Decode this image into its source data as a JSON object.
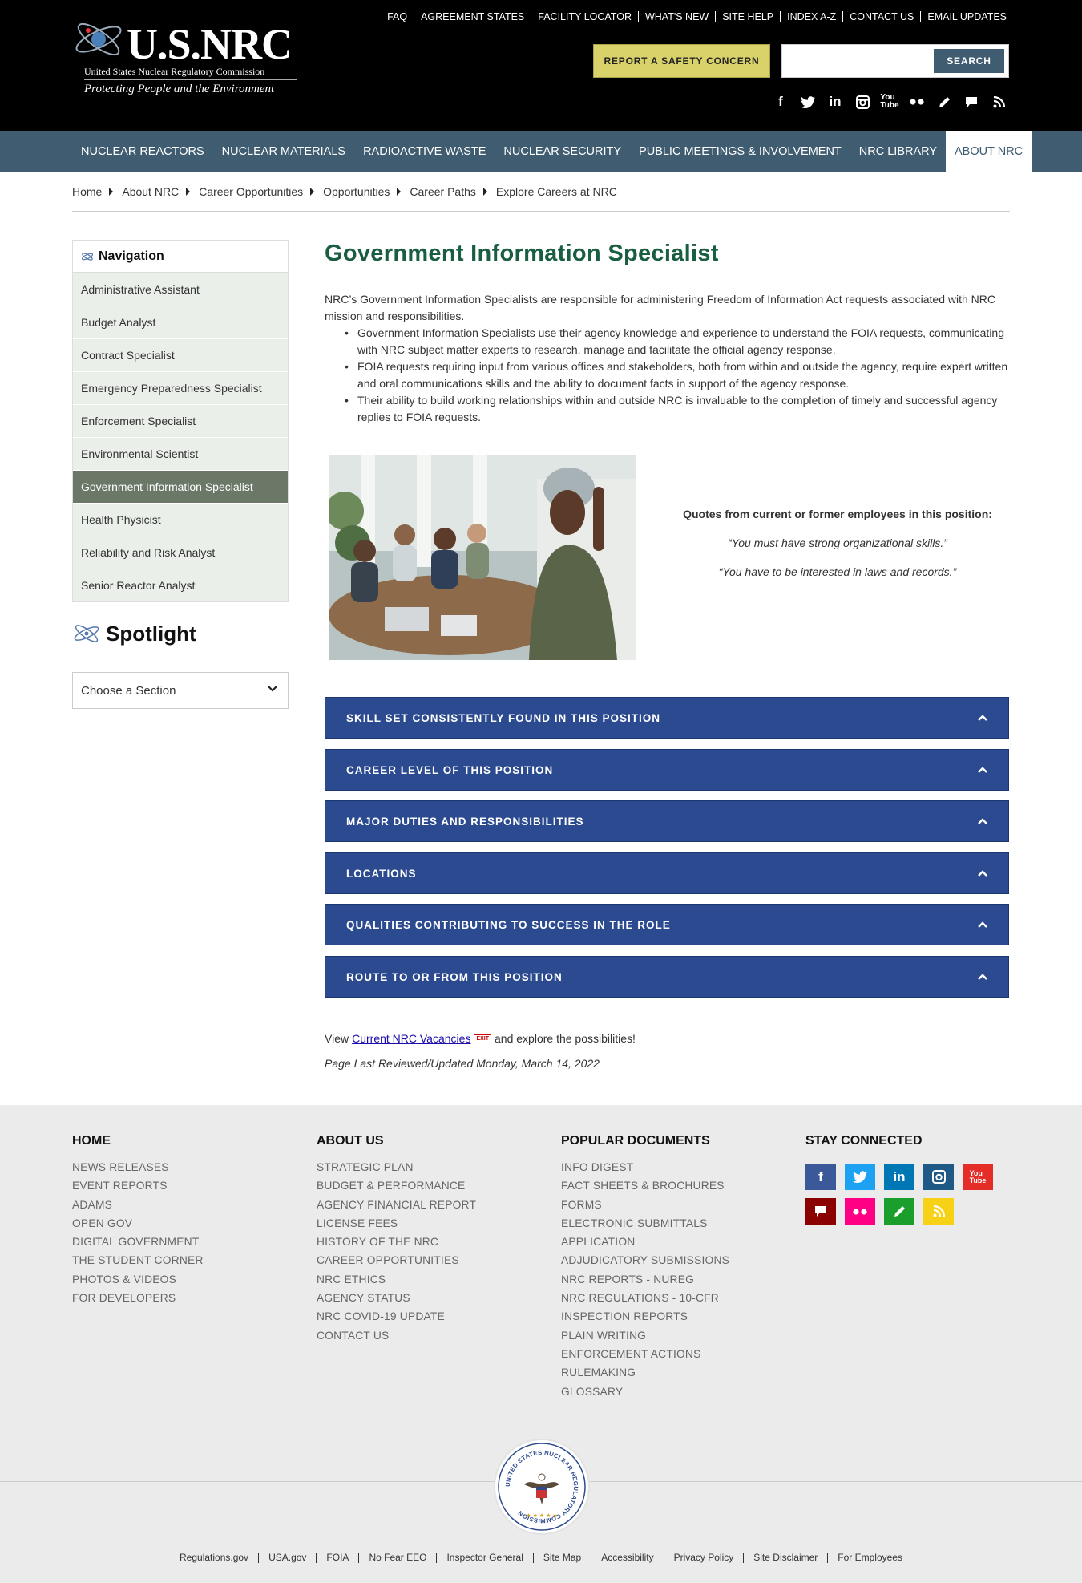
{
  "header": {
    "logo_text": "U.S.NRC",
    "logo_subtitle": "United States Nuclear Regulatory Commission",
    "logo_tagline": "Protecting People and the Environment",
    "util_links": [
      "FAQ",
      "AGREEMENT STATES",
      "FACILITY LOCATOR",
      "WHAT'S NEW",
      "SITE HELP",
      "INDEX A-Z",
      "CONTACT US",
      "EMAIL UPDATES"
    ],
    "report_button": "REPORT A SAFETY CONCERN",
    "search_placeholder": "",
    "search_button": "SEARCH",
    "social_icons": [
      "facebook-icon",
      "twitter-icon",
      "linkedin-icon",
      "instagram-icon",
      "youtube-icon",
      "flickr-icon",
      "blog-icon",
      "comment-icon",
      "rss-icon"
    ]
  },
  "mainnav": {
    "items": [
      "NUCLEAR REACTORS",
      "NUCLEAR MATERIALS",
      "RADIOACTIVE WASTE",
      "NUCLEAR SECURITY",
      "PUBLIC MEETINGS & INVOLVEMENT",
      "NRC LIBRARY",
      "ABOUT NRC"
    ],
    "active": "ABOUT NRC"
  },
  "breadcrumb": [
    "Home",
    "About NRC",
    "Career Opportunities",
    "Opportunities",
    "Career Paths",
    "Explore Careers at NRC"
  ],
  "sidebar": {
    "heading": "Navigation",
    "items": [
      "Administrative Assistant",
      "Budget Analyst",
      "Contract Specialist",
      "Emergency Preparedness Specialist",
      "Enforcement Specialist",
      "Environmental Scientist",
      "Government Information Specialist",
      "Health Physicist",
      "Reliability and Risk Analyst",
      "Senior Reactor Analyst"
    ],
    "active": "Government Information Specialist",
    "spotlight_title": "Spotlight",
    "section_select": "Choose a Section"
  },
  "content": {
    "title": "Government Information Specialist",
    "intro": "NRC’s Government Information Specialists are responsible for administering Freedom of Information Act requests associated with NRC mission and responsibilities.",
    "bullets": [
      "Government Information Specialists use their agency knowledge and experience to understand the FOIA requests, communicating with NRC subject matter experts to research, manage and facilitate the official agency response.",
      "FOIA requests requiring input from various offices and stakeholders, both from within and outside the agency, require expert written and oral communications skills and the ability to document facts in support of the agency response.",
      "Their ability to build working relationships within and outside NRC is invaluable to the completion of timely and successful agency replies to FOIA requests."
    ],
    "quotes_heading": "Quotes from current or former employees in this position:",
    "quotes": [
      "“You must have strong organizational skills.”",
      "“You have to be interested in laws and records.”"
    ],
    "accordions": [
      "SKILL SET CONSISTENTLY FOUND IN THIS POSITION",
      "CAREER LEVEL OF THIS POSITION",
      "MAJOR DUTIES AND RESPONSIBILITIES",
      "LOCATIONS",
      "QUALITIES CONTRIBUTING TO SUCCESS IN THE ROLE",
      "ROUTE TO OR FROM THIS POSITION"
    ],
    "vacancies_prefix": "View",
    "vacancies_link": "Current NRC Vacancies",
    "exit_badge": "EXIT",
    "vacancies_suffix": "and explore the possibilities!",
    "reviewed": "Page Last Reviewed/Updated Monday, March 14, 2022"
  },
  "footer": {
    "columns": [
      {
        "heading": "HOME",
        "links": [
          "NEWS RELEASES",
          "EVENT REPORTS",
          "ADAMS",
          "OPEN GOV",
          "DIGITAL GOVERNMENT",
          "THE STUDENT CORNER",
          "PHOTOS & VIDEOS",
          "FOR DEVELOPERS"
        ]
      },
      {
        "heading": "ABOUT US",
        "links": [
          "STRATEGIC PLAN",
          "BUDGET & PERFORMANCE",
          "AGENCY FINANCIAL REPORT",
          "LICENSE FEES",
          "HISTORY OF THE NRC",
          "CAREER OPPORTUNITIES",
          "NRC ETHICS",
          "AGENCY STATUS",
          "NRC COVID-19 UPDATE",
          "CONTACT US"
        ]
      },
      {
        "heading": "POPULAR DOCUMENTS",
        "links": [
          "INFO DIGEST",
          "FACT SHEETS & BROCHURES",
          "FORMS",
          "ELECTRONIC SUBMITTALS",
          "APPLICATION",
          "ADJUDICATORY SUBMISSIONS",
          "NRC REPORTS - NUREG",
          "NRC REGULATIONS - 10-CFR",
          "INSPECTION REPORTS",
          "PLAIN WRITING",
          "ENFORCEMENT ACTIONS",
          "RULEMAKING",
          "GLOSSARY"
        ]
      }
    ],
    "stay_heading": "STAY CONNECTED",
    "stay_icons": [
      {
        "name": "facebook-icon",
        "color": "#3b5998",
        "glyph": "f"
      },
      {
        "name": "twitter-icon",
        "color": "#1da1f2",
        "glyph": "t"
      },
      {
        "name": "linkedin-icon",
        "color": "#0077b5",
        "glyph": "in"
      },
      {
        "name": "instagram-icon",
        "color": "#1f5a86",
        "glyph": "◎"
      },
      {
        "name": "youtube-icon",
        "color": "#e52d27",
        "glyph": "▶"
      },
      {
        "name": "comment-icon",
        "color": "#8b0000",
        "glyph": "▬"
      },
      {
        "name": "flickr-icon",
        "color": "#ff0084",
        "glyph": "••"
      },
      {
        "name": "blog-icon",
        "color": "#1a9e2c",
        "glyph": "✎"
      },
      {
        "name": "rss-icon",
        "color": "#f7d115",
        "glyph": "))"
      }
    ],
    "seal_text": "UNITED STATES NUCLEAR REGULATORY COMMISSION",
    "bottom_links": [
      "Regulations.gov",
      "USA.gov",
      "FOIA",
      "No Fear EEO",
      "Inspector General",
      "Site Map",
      "Accessibility",
      "Privacy Policy",
      "Site Disclaimer",
      "For Employees"
    ]
  },
  "colors": {
    "nav_bg": "#3f5c70",
    "report_btn": "#d9d26a",
    "title_green": "#195e41",
    "accordion_blue": "#2b4a8f",
    "sidebar_active": "#6b7868"
  }
}
